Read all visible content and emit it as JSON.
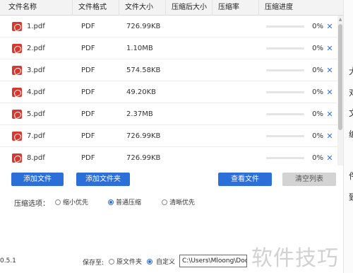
{
  "table": {
    "headers": [
      "文件名称",
      "文件格式",
      "文件大小",
      "压缩后大小",
      "压缩率",
      "压缩进度"
    ],
    "rows": [
      {
        "name": "1.pdf",
        "format": "PDF",
        "size": "726.99KB",
        "compressed_size": "",
        "ratio": "",
        "progress": 0,
        "progress_text": "0%"
      },
      {
        "name": "2.pdf",
        "format": "PDF",
        "size": "1.10MB",
        "compressed_size": "",
        "ratio": "",
        "progress": 0,
        "progress_text": "0%"
      },
      {
        "name": "3.pdf",
        "format": "PDF",
        "size": "574.58KB",
        "compressed_size": "",
        "ratio": "",
        "progress": 0,
        "progress_text": "0%"
      },
      {
        "name": "4.pdf",
        "format": "PDF",
        "size": "49.20KB",
        "compressed_size": "",
        "ratio": "",
        "progress": 0,
        "progress_text": "0%"
      },
      {
        "name": "5.pdf",
        "format": "PDF",
        "size": "2.37MB",
        "compressed_size": "",
        "ratio": "",
        "progress": 0,
        "progress_text": "0%"
      },
      {
        "name": "7.pdf",
        "format": "PDF",
        "size": "726.99KB",
        "compressed_size": "",
        "ratio": "",
        "progress": 0,
        "progress_text": "0%"
      },
      {
        "name": "8.pdf",
        "format": "PDF",
        "size": "726.99KB",
        "compressed_size": "",
        "ratio": "",
        "progress": 0,
        "progress_text": "0%"
      }
    ],
    "delete_glyph": "✕",
    "file_icon": "pdf-file-icon"
  },
  "buttons": {
    "add_file": "添加文件",
    "add_folder": "添加文件夹",
    "view_file": "查看文件",
    "clear_list": "清空列表"
  },
  "compression": {
    "label": "压缩选项：",
    "options": [
      "缩小优先",
      "普通压缩",
      "清晰优先"
    ],
    "selected": "普通压缩"
  },
  "footer": {
    "version": "0.5.1",
    "save_label": "保存至:",
    "save_options": [
      "原文件夹",
      "自定义"
    ],
    "save_selected": "自定义",
    "path": "C:\\Users\\Mloong\\Doc"
  },
  "background_window": {
    "chars": [
      "大",
      "对",
      "文",
      "编",
      "件",
      "致"
    ]
  },
  "watermark": "软件技巧",
  "colors": {
    "accent": "#2d6fd8",
    "pdf_icon": "#d9362e",
    "disabled_button": "#d3d3d3"
  }
}
